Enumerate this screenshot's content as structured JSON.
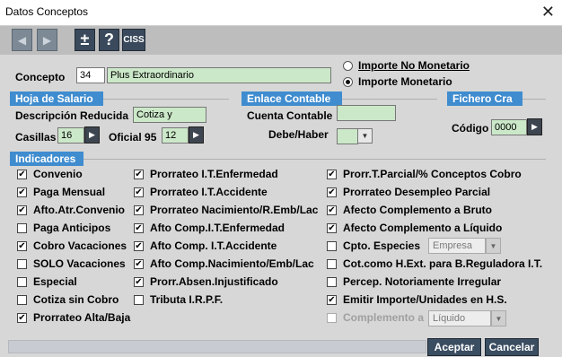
{
  "window": {
    "title": "Datos Conceptos",
    "close_glyph": "✕"
  },
  "toolbar": {
    "prev_glyph": "◀",
    "next_glyph": "▶",
    "plusminus_glyph": "±",
    "help_glyph": "?",
    "ciss_label": "CISS"
  },
  "concepto": {
    "label": "Concepto",
    "code": "34",
    "name": "Plus Extraordinario"
  },
  "importe": {
    "option_no_monetario": "Importe No Monetario",
    "option_monetario": "Importe Monetario",
    "selected": "Importe Monetario"
  },
  "hoja_salario": {
    "header": "Hoja de Salario",
    "descripcion_label": "Descripción Reducida",
    "descripcion_value": "Cotiza y",
    "casillas_label": "Casillas",
    "casillas_value": "16",
    "oficial_label": "Oficial 95",
    "oficial_value": "12"
  },
  "enlace_contable": {
    "header": "Enlace Contable",
    "cuenta_label": "Cuenta Contable",
    "cuenta_value": "",
    "debe_haber_label": "Debe/Haber",
    "debe_haber_value": ""
  },
  "fichero_cra": {
    "header": "Fichero Cra",
    "codigo_label": "Código",
    "codigo_value": "0000"
  },
  "indicadores": {
    "header": "Indicadores",
    "col1": [
      {
        "label": "Convenio",
        "checked": true
      },
      {
        "label": "Paga Mensual",
        "checked": true
      },
      {
        "label": "Afto.Atr.Convenio",
        "checked": true
      },
      {
        "label": "Paga Anticipos",
        "checked": false
      },
      {
        "label": "Cobro Vacaciones",
        "checked": true
      },
      {
        "label": "SOLO Vacaciones",
        "checked": false
      },
      {
        "label": "Especial",
        "checked": false
      },
      {
        "label": "Cotiza sin Cobro",
        "checked": false
      },
      {
        "label": "Prorrateo Alta/Baja",
        "checked": true
      }
    ],
    "col2": [
      {
        "label": "Prorrateo I.T.Enfermedad",
        "checked": true
      },
      {
        "label": "Prorrateo I.T.Accidente",
        "checked": true
      },
      {
        "label": "Prorrateo Nacimiento/R.Emb/Lac",
        "checked": true
      },
      {
        "label": "Afto Comp.I.T.Enfermedad",
        "checked": true
      },
      {
        "label": "Afto Comp. I.T.Accidente",
        "checked": true
      },
      {
        "label": "Afto Comp.Nacimiento/Emb/Lac",
        "checked": true
      },
      {
        "label": "Prorr.Absen.Injustificado",
        "checked": true
      },
      {
        "label": "Tributa I.R.P.F.",
        "checked": false
      }
    ],
    "col3": [
      {
        "label": "Prorr.T.Parcial/% Conceptos Cobro",
        "checked": true
      },
      {
        "label": "Prorrateo Desempleo Parcial",
        "checked": true
      },
      {
        "label": "Afecto Complemento a Bruto",
        "checked": true
      },
      {
        "label": "Afecto Complemento a Líquido",
        "checked": true
      },
      {
        "label": "Cpto. Especies",
        "checked": false
      },
      {
        "label": "Cot.como H.Ext. para B.Reguladora I.T.",
        "checked": false
      },
      {
        "label": "Percep. Notoriamente Irregular",
        "checked": false
      },
      {
        "label": "Emitir Importe/Unidades en H.S.",
        "checked": true
      },
      {
        "label": "Complemento a",
        "checked": false,
        "disabled": true
      }
    ],
    "especies_combo": "Empresa",
    "complemento_combo": "Líquido"
  },
  "footer": {
    "accept_label": "Aceptar",
    "cancel_label": "Cancelar"
  },
  "colors": {
    "section_header": "#3f8ccf",
    "input_green": "#cbe8c8",
    "button_dark": "#3a4d61"
  }
}
